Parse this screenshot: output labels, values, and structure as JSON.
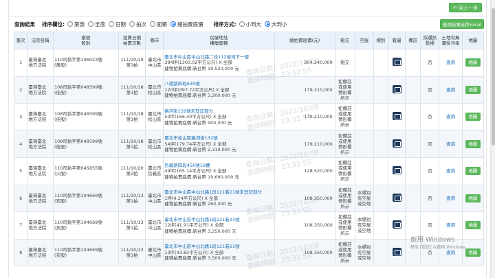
{
  "header": {
    "back_label": "回上一步"
  },
  "filters": {
    "result_label": "查詢結果",
    "sort_field_label": "排序欄位:",
    "sort_fields": [
      {
        "label": "案號",
        "selected": false
      },
      {
        "label": "坐落",
        "selected": false
      },
      {
        "label": "日期",
        "selected": false
      },
      {
        "label": "拍次",
        "selected": false
      },
      {
        "label": "面積",
        "selected": false
      },
      {
        "label": "總拍賣底價",
        "selected": true
      }
    ],
    "sort_order_label": "排序方式:",
    "sort_orders": [
      {
        "label": "小到大",
        "selected": false
      },
      {
        "label": "大到小",
        "selected": true
      }
    ],
    "export_label": "查詢結果另存Excel"
  },
  "table": {
    "headers": [
      {
        "l1": "筆次",
        "l2": ""
      },
      {
        "l1": "法院名稱",
        "l2": ""
      },
      {
        "l1": "案號",
        "l2": "股別"
      },
      {
        "l1": "拍賣日期",
        "l2": "拍賣次數"
      },
      {
        "l1": "縣市",
        "l2": ""
      },
      {
        "l1": "房屋地址",
        "l2": "樓層面積"
      },
      {
        "l1": "總拍賣底價(元)",
        "l2": ""
      },
      {
        "l1": "點交",
        "l2": ""
      },
      {
        "l1": "空屋",
        "l2": ""
      },
      {
        "l1": "標別",
        "l2": ""
      },
      {
        "l1": "看圖",
        "l2": ""
      },
      {
        "l1": "備註",
        "l2": ""
      },
      {
        "l1": "採通訊",
        "l2": "投標"
      },
      {
        "l1": "土地有無",
        "l2": "遭受污染"
      },
      {
        "l1": "地圖",
        "l2": ""
      }
    ],
    "query_label": "查詢",
    "map_label": "地圖",
    "rows": [
      {
        "no": "1",
        "court": [
          "臺灣臺北",
          "地方法院"
        ],
        "case": [
          "110司執字第106023號",
          "(黃股)"
        ],
        "date": [
          "111/10/19",
          "第3拍"
        ],
        "city": [
          "臺北市",
          "中山區"
        ],
        "addr": [
          "臺北市中山區中山北路二段112號地下一層",
          "394坪(1303.02平方公尺) X 全部",
          "建物拍賣底價:新台幣 19,520,000 元"
        ],
        "price": "204,240,000",
        "handover": [
          "點交"
        ],
        "vacant": [
          "",
          "",
          ""
        ],
        "remark": "",
        "mail_bid": "否"
      },
      {
        "no": "2",
        "court": [
          "臺灣臺北",
          "地方法院"
        ],
        "case": [
          "108司執字第048599號",
          "(佳股)"
        ],
        "date": [
          "111/10/18",
          "第1拍"
        ],
        "city": [
          "臺北市",
          "松山區"
        ],
        "addr": [
          "八德路四段635號",
          "120坪(397.72平方公尺) X 全部",
          "建物拍賣底價:新台幣 3,200,000 元"
        ],
        "price": "179,210,000",
        "handover": [
          "如備註",
          "或使用",
          "情形欄",
          "所示"
        ],
        "vacant": [
          "",
          "",
          ""
        ],
        "remark": "",
        "mail_bid": "否"
      },
      {
        "no": "3",
        "court": [
          "臺灣臺北",
          "地方法院"
        ],
        "case": [
          "108司執字第048599號",
          "(佳股)"
        ],
        "date": [
          "111/10/18",
          "第1拍"
        ],
        "city": [
          "臺北市",
          "松山區"
        ],
        "addr": [
          "饒河街132號未登記部分",
          "50坪(166.40平方公尺) X 全部",
          "建物拍賣底價:新台幣 900,000 元"
        ],
        "price": "179,210,000",
        "handover": [
          "如備註",
          "或使用",
          "情形欄",
          "所示"
        ],
        "vacant": [
          "",
          "",
          ""
        ],
        "remark": "",
        "mail_bid": "否"
      },
      {
        "no": "4",
        "court": [
          "臺灣臺北",
          "地方法院"
        ],
        "case": [
          "108司執字第048599號",
          "(佳股)"
        ],
        "date": [
          "111/10/18",
          "第1拍"
        ],
        "city": [
          "臺北市",
          "松山區"
        ],
        "addr": [
          "臺北市松山區饒河街132號",
          "54坪(179.74平方公尺) X 全部",
          "建物拍賣底價:新台幣 2,310,000 元"
        ],
        "price": "179,210,000",
        "handover": [
          "如備註",
          "或使用",
          "情形欄",
          "所示"
        ],
        "vacant": [
          "",
          "",
          ""
        ],
        "remark": "",
        "mail_bid": "否"
      },
      {
        "no": "5",
        "court": [
          "臺灣臺北",
          "地方法院"
        ],
        "case": [
          "110司執字第045855號",
          "(火股)"
        ],
        "date": [
          "111/10/20",
          "第2拍"
        ],
        "city": [
          "臺北市",
          "信義區"
        ],
        "addr": [
          "信義路四段456號16樓",
          "49坪(165.14平方公尺) X 全部",
          "建物拍賣底價:新台幣 19,660,000 元"
        ],
        "price": "128,520,000",
        "handover": [
          "如備註",
          "或使用",
          "情形欄",
          "所示"
        ],
        "vacant": [
          "",
          "",
          ""
        ],
        "remark": "",
        "mail_bid": "否"
      },
      {
        "no": "6",
        "court": [
          "臺灣臺北",
          "地方法院"
        ],
        "case": [
          "110司執字第104669號",
          "(亥股)"
        ],
        "date": [
          "111/10/13",
          "第1拍"
        ],
        "city": [
          "臺北市",
          "中山區"
        ],
        "addr": [
          "臺北市中山區中山北路1段121巷21號未登記部分",
          "1坪(4.24平方公尺) X 全部",
          "建物拍賣底價:新台幣 260,000 元"
        ],
        "price": "108,350,000",
        "handover": [
          "如備註",
          "或使用",
          "情形欄",
          "所示"
        ],
        "vacant": [
          "本標別",
          "有空屋",
          "或空地"
        ],
        "remark": "",
        "mail_bid": "否"
      },
      {
        "no": "7",
        "court": [
          "臺灣臺北",
          "地方法院"
        ],
        "case": [
          "110司執字第104669號",
          "(亥股)"
        ],
        "date": [
          "111/10/13",
          "第1拍"
        ],
        "city": [
          "臺北市",
          "中山區"
        ],
        "addr": [
          "臺北市中山區中山北路1段121巷23號",
          "12坪(41.91平方公尺) X 全部",
          "建物拍賣底價:新台幣 3,250,000 元"
        ],
        "price": "108,350,000",
        "handover": [
          "如備註",
          "或使用",
          "情形欄",
          "所示"
        ],
        "vacant": [
          "本標別",
          "有空屋",
          "或空地"
        ],
        "remark": "",
        "mail_bid": "否"
      },
      {
        "no": "8",
        "court": [
          "臺灣臺北",
          "地方法院"
        ],
        "case": [
          "110司執字第104669號",
          "(亥股)"
        ],
        "date": [
          "111/10/13",
          "第1拍"
        ],
        "city": [
          "臺北市",
          "中山區"
        ],
        "addr": [
          "臺北市中山區中山北路1段121巷21號",
          "13坪(43.82平方公尺) X 全部",
          "建物拍賣底價:新台幣 3,500,000 元"
        ],
        "price": "108,350,000",
        "handover": [
          "如備註",
          "或使用",
          "情形欄",
          "所示"
        ],
        "vacant": [
          "本標別",
          "有空屋",
          "或空地"
        ],
        "remark": "",
        "mail_bid": "否"
      }
    ]
  },
  "watermark": {
    "line1": "查詢日期：2022/10/08",
    "line2": "查詢時間：23:32:55"
  },
  "windows": {
    "line1": "啟用 Windows",
    "line2": "移至 [設定] 以啟用 Windows。"
  }
}
